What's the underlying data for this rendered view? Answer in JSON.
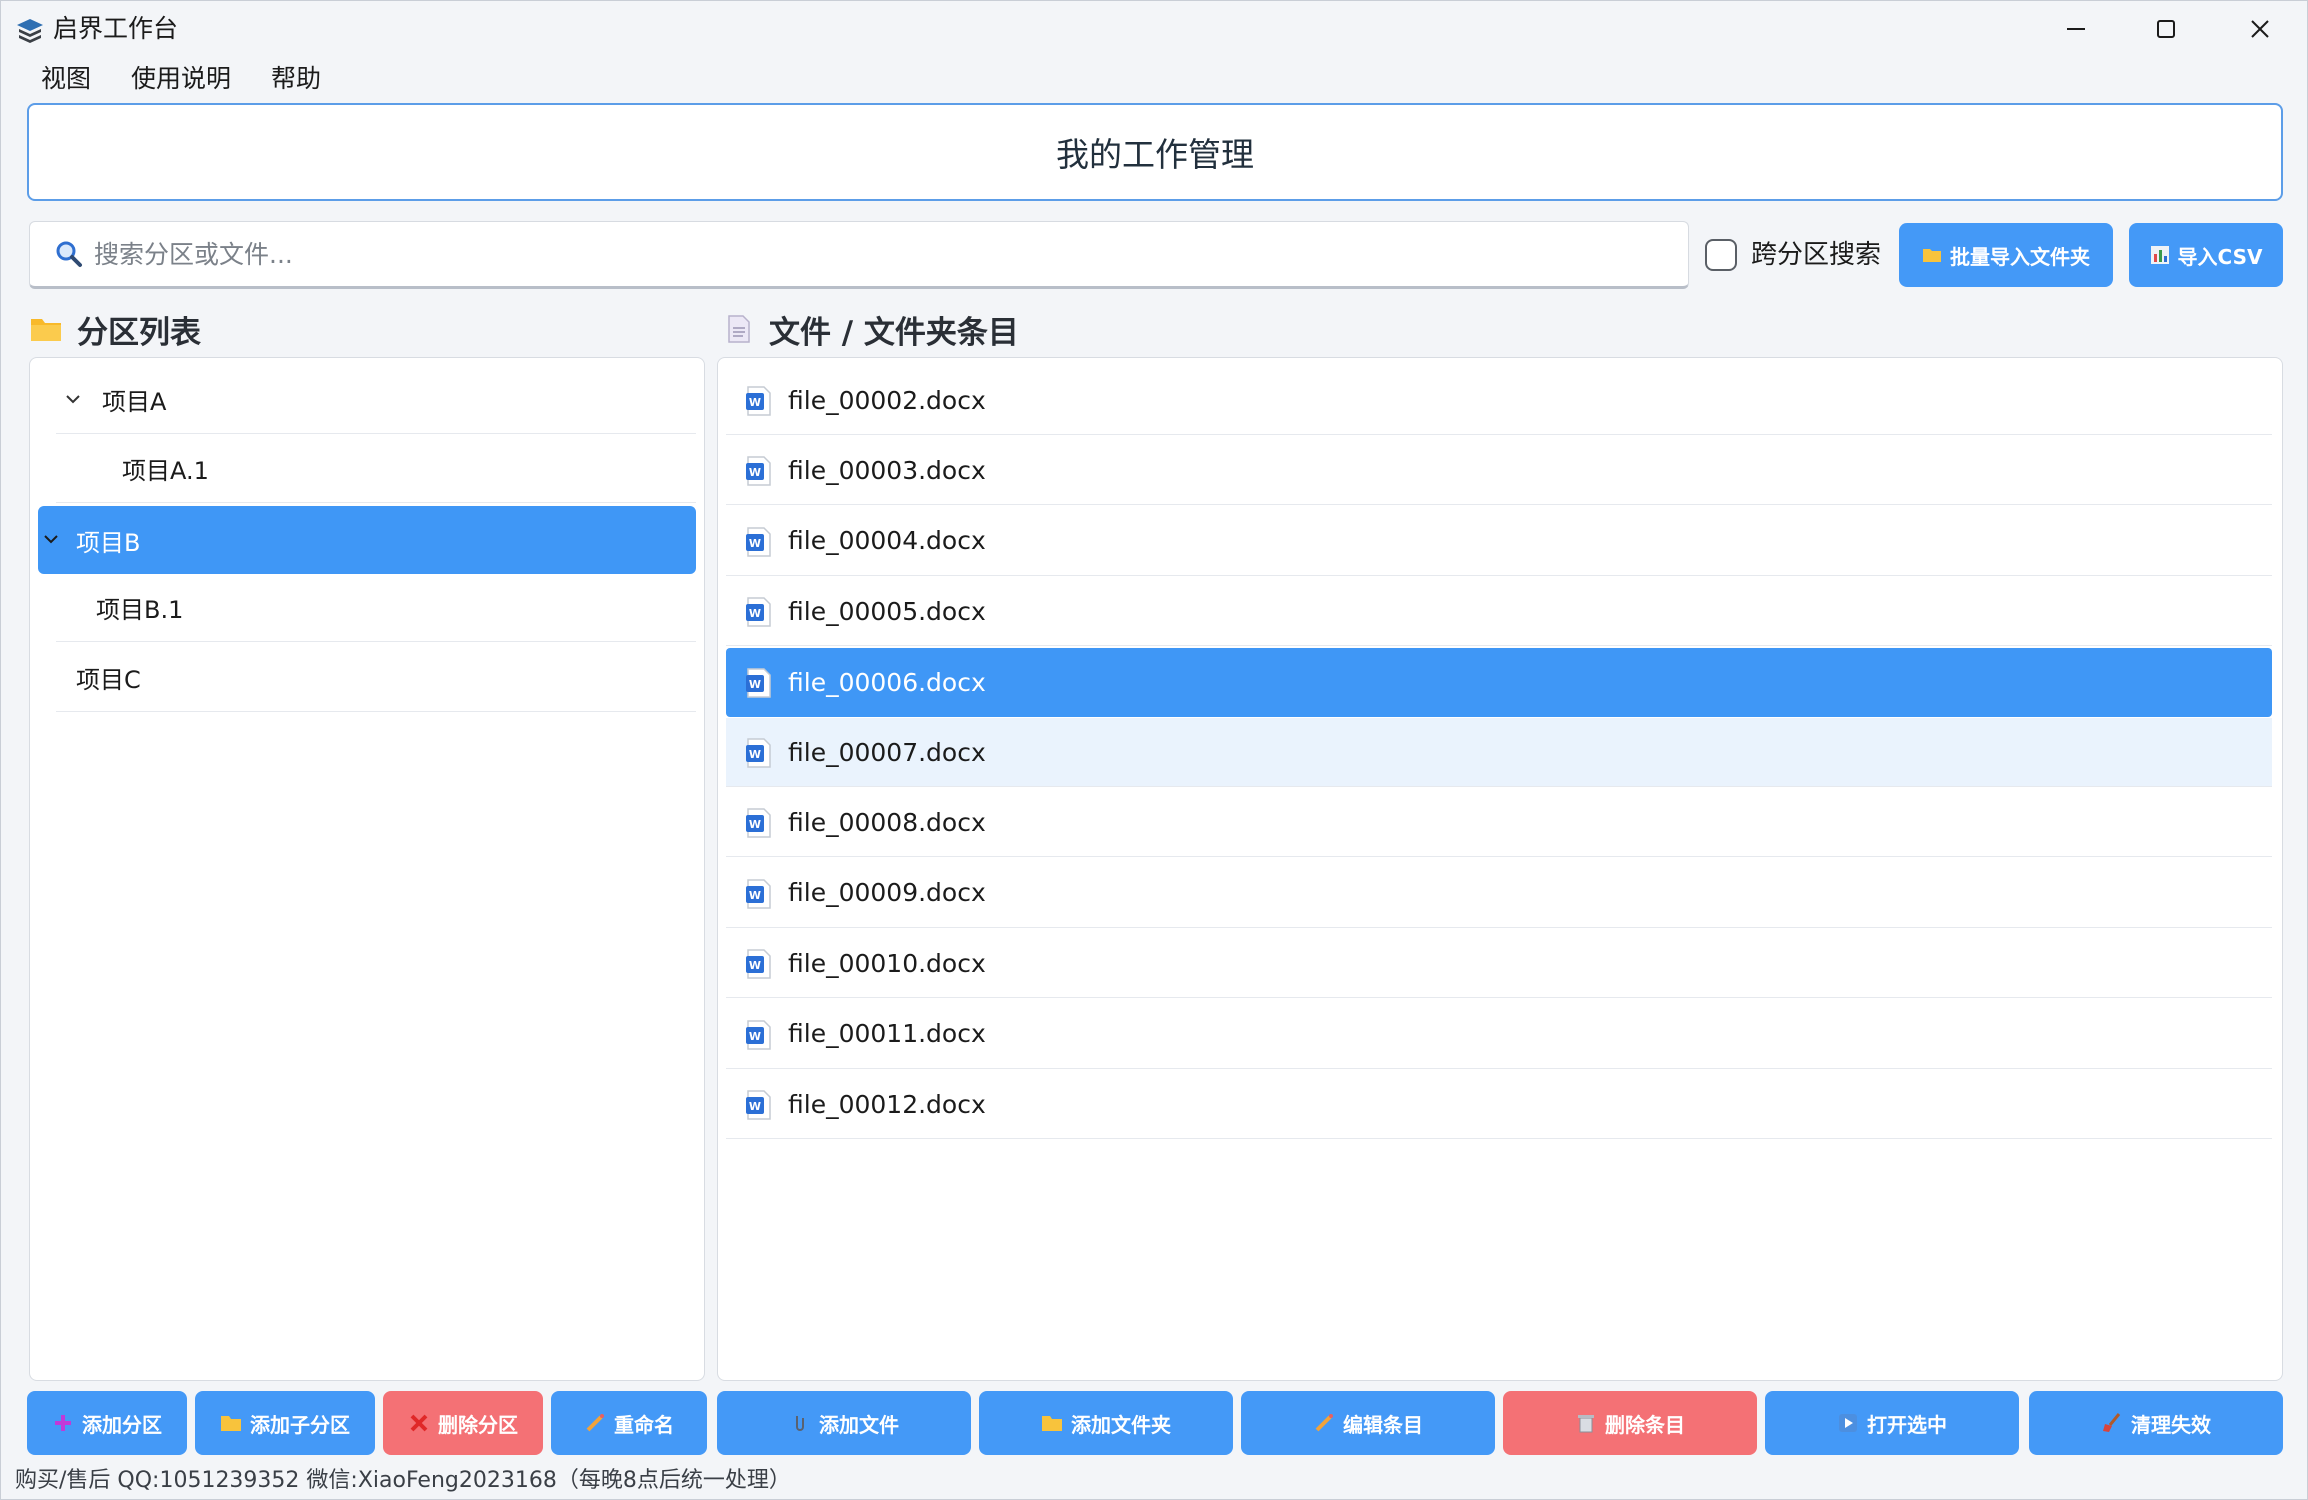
{
  "window": {
    "title": "启界工作台"
  },
  "menu": [
    "视图",
    "使用说明",
    "帮助"
  ],
  "header": {
    "title": "我的工作管理"
  },
  "search": {
    "placeholder": "搜索分区或文件...",
    "value": ""
  },
  "cross_search": {
    "label": "跨分区搜索",
    "checked": false
  },
  "top_buttons": {
    "batch_import": "批量导入文件夹",
    "import_csv": "导入CSV"
  },
  "partitions": {
    "heading": "分区列表",
    "items": [
      {
        "label": "项目A",
        "level": 0,
        "expanded": true,
        "selected": false
      },
      {
        "label": "项目A.1",
        "level": 1,
        "expanded": false,
        "selected": false
      },
      {
        "label": "项目B",
        "level": 0,
        "expanded": true,
        "selected": true
      },
      {
        "label": "项目B.1",
        "level": 1,
        "expanded": false,
        "selected": false
      },
      {
        "label": "项目C",
        "level": 0,
        "expanded": false,
        "selected": false
      }
    ]
  },
  "files": {
    "heading": "文件 / 文件夹条目",
    "items": [
      {
        "name": "file_00002.docx",
        "state": "normal"
      },
      {
        "name": "file_00003.docx",
        "state": "normal"
      },
      {
        "name": "file_00004.docx",
        "state": "normal"
      },
      {
        "name": "file_00005.docx",
        "state": "normal"
      },
      {
        "name": "file_00006.docx",
        "state": "selected"
      },
      {
        "name": "file_00007.docx",
        "state": "hover"
      },
      {
        "name": "file_00008.docx",
        "state": "normal"
      },
      {
        "name": "file_00009.docx",
        "state": "normal"
      },
      {
        "name": "file_00010.docx",
        "state": "normal"
      },
      {
        "name": "file_00011.docx",
        "state": "normal"
      },
      {
        "name": "file_00012.docx",
        "state": "normal"
      }
    ]
  },
  "bottom_buttons": {
    "add_partition": "添加分区",
    "add_sub_partition": "添加子分区",
    "delete_partition": "删除分区",
    "rename": "重命名",
    "add_file": "添加文件",
    "add_folder": "添加文件夹",
    "edit_entry": "编辑条目",
    "delete_entry": "删除条目",
    "open_selected": "打开选中",
    "clean_invalid": "清理失效"
  },
  "status": {
    "text": "购买/售后 QQ:1051239352 微信:XiaoFeng2023168（每晚8点后统一处理）"
  },
  "colors": {
    "accent": "#4499f7",
    "danger": "#f47175",
    "selected": "#3f97f6",
    "hover": "#eaf3fd"
  }
}
